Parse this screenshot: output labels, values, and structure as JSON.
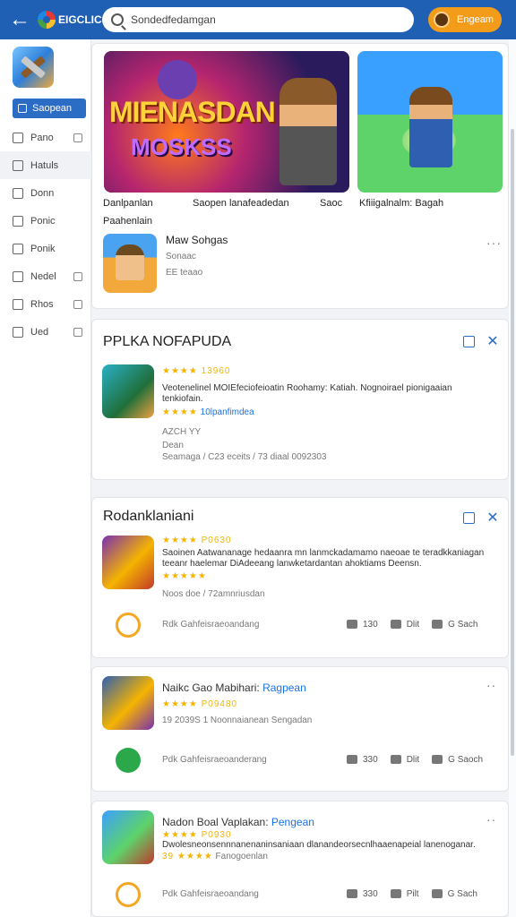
{
  "topbar": {
    "logo_text": "EIGCLIC",
    "search_value": "Sondedfedamgan",
    "signin_label": "Engeam"
  },
  "sidebar": {
    "items": [
      {
        "label": "Saopean"
      },
      {
        "label": "Pano"
      },
      {
        "label": "Hatuls"
      },
      {
        "label": "Donn"
      },
      {
        "label": "Ponic"
      },
      {
        "label": "Ponik"
      },
      {
        "label": "Nedel"
      },
      {
        "label": "Rhos"
      },
      {
        "label": "Ued"
      }
    ]
  },
  "featured": {
    "banner_title": "MIENASDAN",
    "banner_subtitle": "MOSKSS",
    "captions": [
      "Danlpanlan",
      "Saopen lanafeadedan",
      "Saoc",
      "Kfiiigalnalm: Bagah",
      "Paahenlain"
    ],
    "row": {
      "title": "Maw Sohgas",
      "sub1": "Sonaac",
      "sub2": "EE  teaao"
    }
  },
  "section1": {
    "title": "PPLKA NOFAPUDA",
    "rating": "★★★★  13960",
    "desc": "Veotenelinel MOIEfeciofeioatin Roohamy: Katiah. Nognoirael pionigaaian",
    "desc2": "tenkiofain.",
    "tag_stars": "★★★★",
    "tag_link": "10lpanfimdea",
    "meta1": "AZCH YY",
    "meta2": "Dean",
    "meta3": "Seamaga / C23 eceits  / 73 diaal  0092303"
  },
  "section2": {
    "title": "Rodanklaniani",
    "rating": "★★★★  P0630",
    "desc": "Saoinen Aatwananage hedaanra mn lanmckadamamo naeoae te teradkkaniagan",
    "desc2": "teeanr haelemar DiAdeeang lanwketardantan ahoktiams Deensn.",
    "stars2": "★★★★★",
    "meta": "Noos doe / 72amnriusdan",
    "footer_text": "Rdk Gahfeisraeoandang",
    "likes": "130",
    "comments": "Dlit",
    "share": "G Sach"
  },
  "section3": {
    "title": "Naikc Gao Mabihari:",
    "title_link": "Ragpean",
    "rating": "★★★★  P09480",
    "meta": "19 2039S  1 Noonnaianean Sengadan",
    "footer_text": "Pdk Gahfeisraeoanderang",
    "likes": "330",
    "comments": "Dlit",
    "share": "G Saoch"
  },
  "section4": {
    "title": "Nadon Boal Vaplakan:",
    "title_link": "Pengean",
    "rating": "★★★★  P0930",
    "desc": "Dwolesneonsennnanenaninsaniaan dlanandeorsecnlhaaenapeial lanenoganar.",
    "stars_prefix": "39 ★★★★",
    "meta": "Fanogoenlan",
    "footer_text": "Pdk Gahfeisraeoandang",
    "likes": "330",
    "comments": "Pilt",
    "share": "G Sach"
  }
}
